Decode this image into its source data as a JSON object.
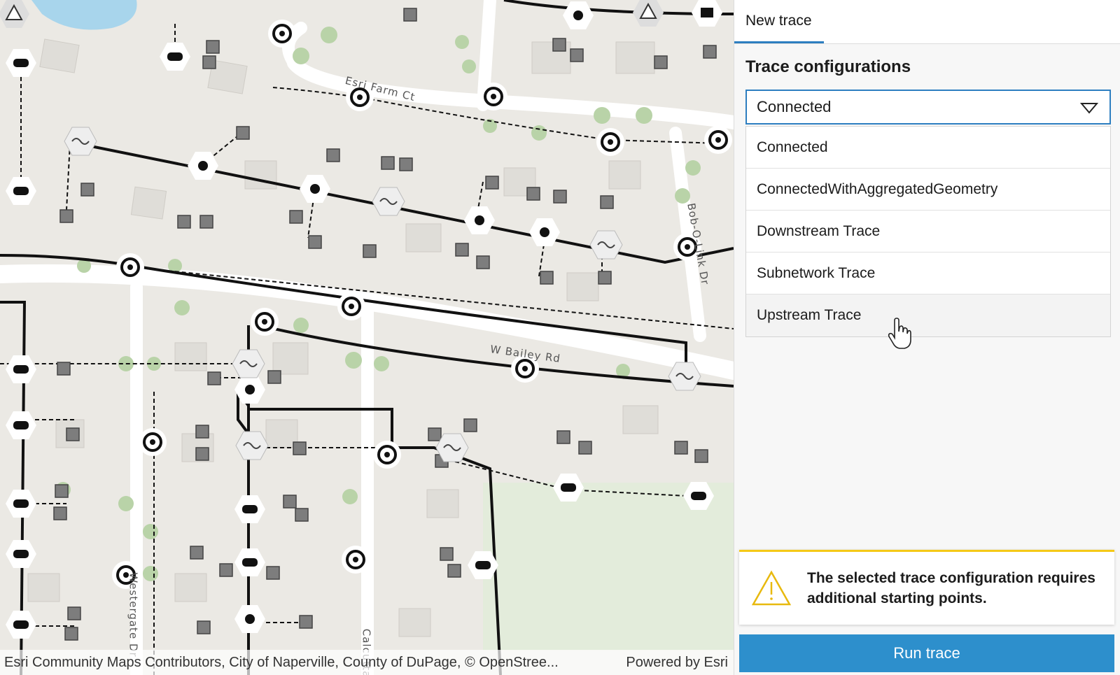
{
  "map": {
    "street_labels": [
      "Esri Farm Ct",
      "W Bailey Rd",
      "Bob-O-Link Dr",
      "Westergate Dr",
      "Calcutta"
    ],
    "attribution_text": "Esri Community Maps Contributors, City of Naperville, County of DuPage, © OpenStree...",
    "powered_by": "Powered by Esri"
  },
  "panel": {
    "tabs": [
      {
        "label": "New trace"
      }
    ],
    "section_title": "Trace configurations",
    "selected_config": "Connected",
    "options": [
      "Connected",
      "ConnectedWithAggregatedGeometry",
      "Downstream Trace",
      "Subnetwork Trace",
      "Upstream Trace"
    ],
    "hovered_option": "Upstream Trace",
    "warning_text": "The selected trace configuration requires additional starting points.",
    "run_button_label": "Run trace"
  },
  "colors": {
    "accent": "#2d7ec0",
    "button": "#2d8fcc",
    "warning": "#f5c917"
  },
  "icons": [
    "chevron-down-icon",
    "warning-icon",
    "hand-cursor-icon",
    "utility-node-icon"
  ]
}
